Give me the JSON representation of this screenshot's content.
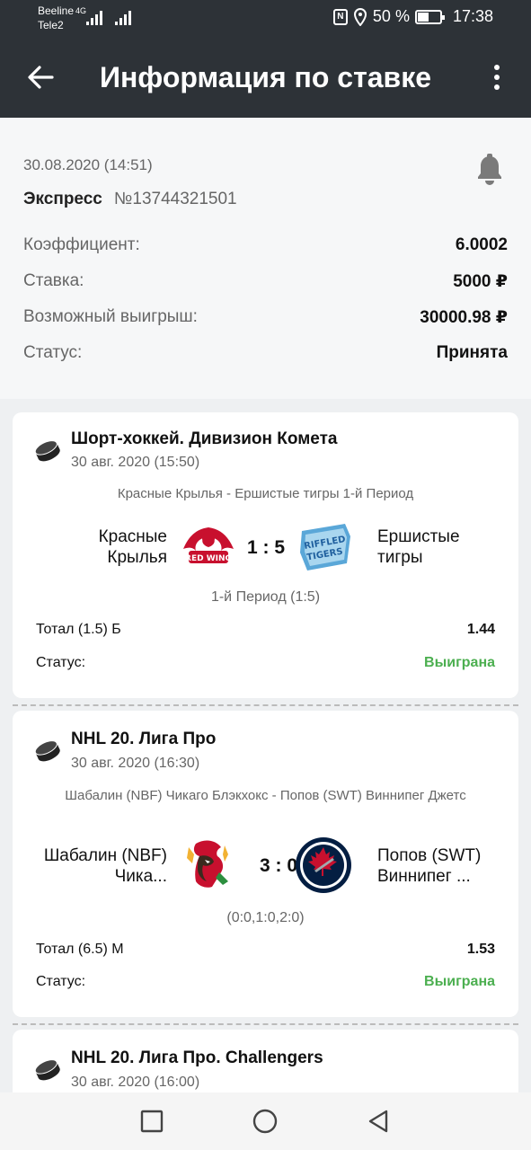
{
  "status_bar": {
    "carrier1": "Beeline",
    "carrier2": "Tele2",
    "network": "4G",
    "battery": "50 %",
    "time": "17:38"
  },
  "appbar": {
    "title": "Информация по ставке"
  },
  "summary": {
    "datetime": "30.08.2020 (14:51)",
    "type": "Экспресс",
    "number": "№13744321501",
    "rows": [
      {
        "label": "Коэффициент:",
        "value": "6.0002"
      },
      {
        "label": "Ставка:",
        "value": "5000 ₽"
      },
      {
        "label": "Возможный выигрыш:",
        "value": "30000.98 ₽"
      },
      {
        "label": "Статус:",
        "value": "Принята"
      }
    ]
  },
  "events": [
    {
      "league": "Шорт-хоккей. Дивизион Комета",
      "date": "30 авг. 2020 (15:50)",
      "match": "Красные Крылья - Ершистые тигры 1-й Период",
      "team1": "Красные Крылья",
      "team2": "Ершистые тигры",
      "score": "1 : 5",
      "period": "1-й Период (1:5)",
      "bet_label": "Тотал (1.5) Б",
      "bet_odds": "1.44",
      "status_label": "Статус:",
      "status_value": "Выиграна"
    },
    {
      "league": "NHL 20. Лига Про",
      "date": "30 авг. 2020 (16:30)",
      "match": "Шабалин (NBF) Чикаго Блэкхокс - Попов (SWT) Виннипег Джетс",
      "team1": "Шабалин (NBF) Чика...",
      "team2": "Попов (SWT) Виннипег ...",
      "score": "3 : 0",
      "period": "(0:0,1:0,2:0)",
      "bet_label": "Тотал (6.5) М",
      "bet_odds": "1.53",
      "status_label": "Статус:",
      "status_value": "Выиграна"
    },
    {
      "league": "NHL 20. Лига Про. Challengers",
      "date": "30 авг. 2020 (16:00)"
    }
  ]
}
